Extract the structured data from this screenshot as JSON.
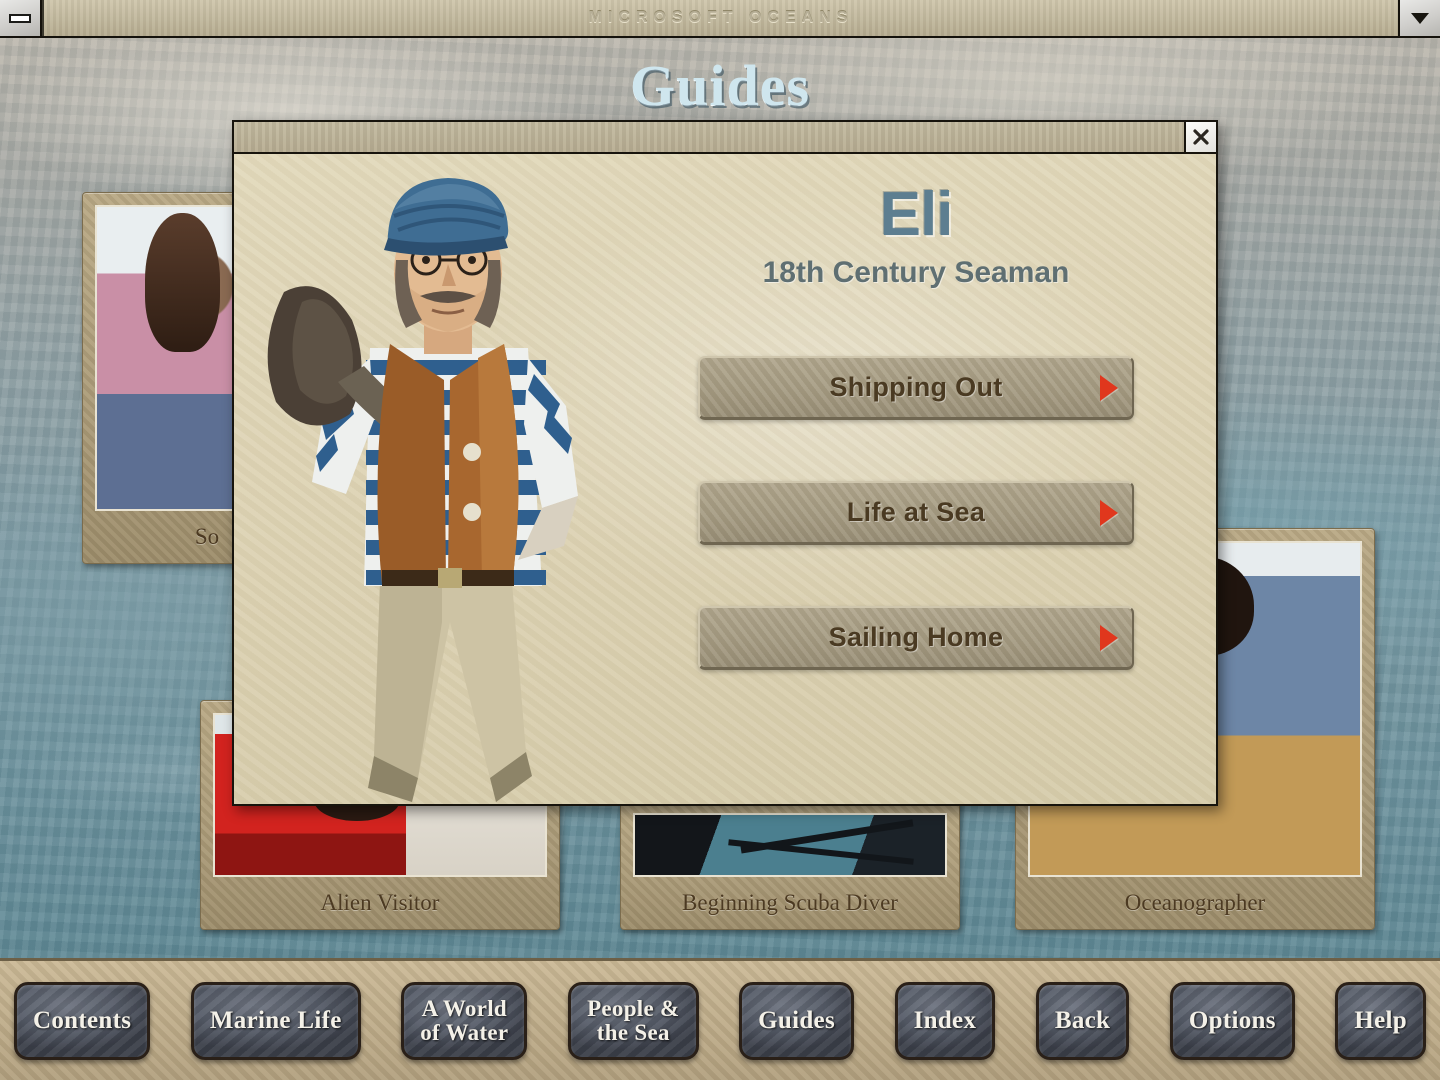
{
  "window": {
    "title": "MICROSOFT OCEANS",
    "minimize_icon": "minimize-icon",
    "restore_icon": "chevron-down-icon"
  },
  "page": {
    "title": "Guides"
  },
  "cards": [
    {
      "caption": "So",
      "art": "fig-socio",
      "name": "card-sociologist"
    },
    {
      "caption": "Alien Visitor",
      "art": "fig-alien",
      "name": "card-alien-visitor"
    },
    {
      "caption": "Beginning Scuba Diver",
      "art": "fig-scuba",
      "name": "card-beginning-scuba-diver"
    },
    {
      "caption": "Oceanographer",
      "art": "fig-ocean",
      "name": "card-oceanographer"
    }
  ],
  "dialog": {
    "close_label": "✕",
    "close_icon": "close-icon",
    "guide_name": "Eli",
    "guide_role": "18th Century Seaman",
    "portrait_alt": "eli-seaman-portrait",
    "topics": [
      {
        "label": "Shipping Out",
        "arrow_icon": "play-arrow-icon"
      },
      {
        "label": "Life at Sea",
        "arrow_icon": "play-arrow-icon"
      },
      {
        "label": "Sailing Home",
        "arrow_icon": "play-arrow-icon"
      }
    ]
  },
  "nav": [
    {
      "label": "Contents",
      "lines": 1
    },
    {
      "label": "Marine Life",
      "lines": 1
    },
    {
      "label": "A World\nof Water",
      "lines": 2
    },
    {
      "label": "People &\nthe Sea",
      "lines": 2
    },
    {
      "label": "Guides",
      "lines": 1
    },
    {
      "label": "Index",
      "lines": 1
    },
    {
      "label": "Back",
      "lines": 1
    },
    {
      "label": "Options",
      "lines": 1
    },
    {
      "label": "Help",
      "lines": 1
    }
  ],
  "colors": {
    "accent_arrow": "#e0371d",
    "guide_name": "#5d7e90",
    "parchment": "#ded4b5",
    "button_face": "#a59b82",
    "nav_button": "#565c68",
    "title_blue": "#cfe6ee"
  }
}
